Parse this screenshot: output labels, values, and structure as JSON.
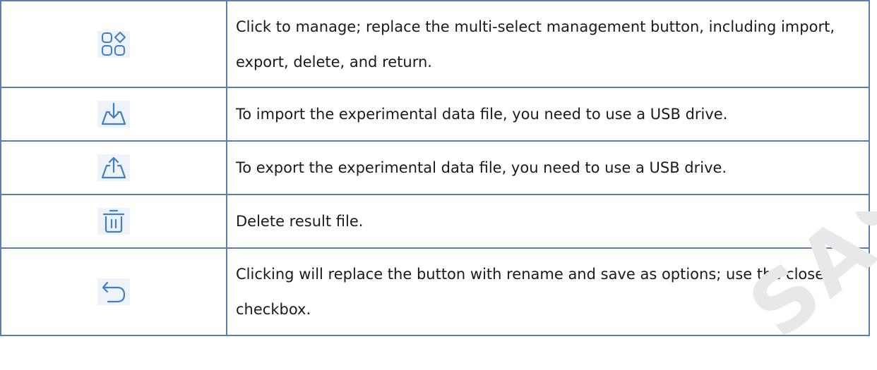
{
  "table": {
    "rows": [
      {
        "icon": "manage-grid-icon",
        "description": "Click to manage; replace the multi-select management button, including import, export, delete, and return."
      },
      {
        "icon": "import-icon",
        "description": "To import the experimental data file, you need to use a USB drive."
      },
      {
        "icon": "export-icon",
        "description": "To export the experimental data file, you need to use a USB drive."
      },
      {
        "icon": "trash-icon",
        "description": "Delete result file."
      },
      {
        "icon": "return-arrow-icon",
        "description": "Clicking will replace the button with rename and save as options; use the close checkbox."
      }
    ]
  },
  "watermark": {
    "text": "SAS"
  },
  "colors": {
    "border": "#5b7fb0",
    "icon": "#3f7fc4",
    "icon_background": "#eef3fa",
    "text": "#1a1a1a"
  }
}
